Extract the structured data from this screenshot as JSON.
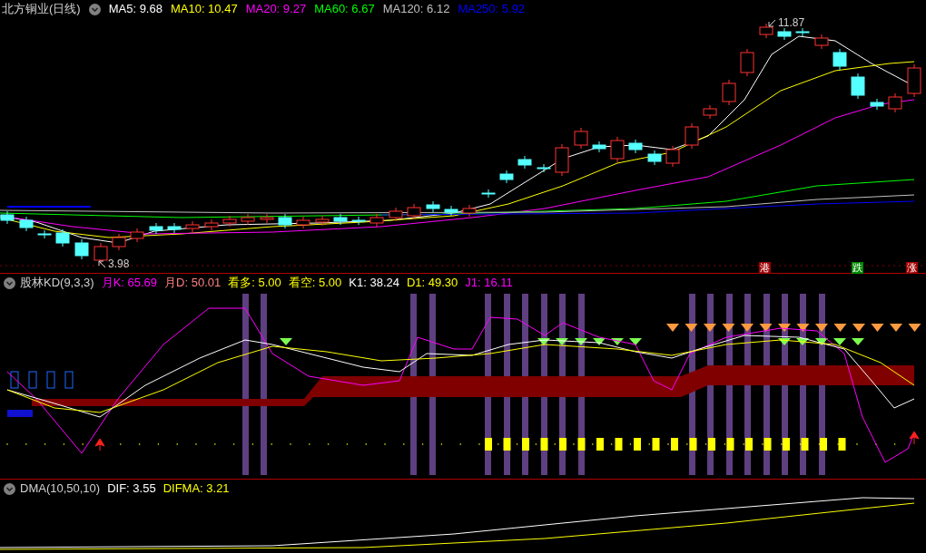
{
  "main_panel": {
    "title": "北方铜业(日线)",
    "indicators": [
      {
        "label": "MA5: 9.68",
        "color": "#ffffff"
      },
      {
        "label": "MA10: 10.47",
        "color": "#ffff00"
      },
      {
        "label": "MA20: 9.27",
        "color": "#ff00ff"
      },
      {
        "label": "MA60: 6.67",
        "color": "#00ff00"
      },
      {
        "label": "MA120: 6.12",
        "color": "#c0c0c0"
      },
      {
        "label": "MA250: 5.92",
        "color": "#0000ff"
      }
    ],
    "high_label": "11.87",
    "low_label": "3.98",
    "signals": [
      {
        "text": "港",
        "color": "#a00000"
      },
      {
        "text": "跌",
        "color": "#008800"
      },
      {
        "text": "涨",
        "color": "#a00000"
      }
    ]
  },
  "kd_panel": {
    "title": "股林KD(9,3,3)",
    "indicators": [
      {
        "label": "月K: 65.69",
        "color": "#ff00ff"
      },
      {
        "label": "月D: 50.01",
        "color": "#ff8080"
      },
      {
        "label": "看多: 5.00",
        "color": "#ffff00"
      },
      {
        "label": "看空: 5.00",
        "color": "#ffff00"
      },
      {
        "label": "K1: 38.24",
        "color": "#ffffff"
      },
      {
        "label": "D1: 49.30",
        "color": "#ffff00"
      },
      {
        "label": "J1: 16.11",
        "color": "#ff00ff"
      }
    ]
  },
  "dma_panel": {
    "title": "DMA(10,50,10)",
    "indicators": [
      {
        "label": "DIF: 3.55",
        "color": "#ffffff"
      },
      {
        "label": "DIFMA: 3.21",
        "color": "#ffff00"
      }
    ]
  }
}
